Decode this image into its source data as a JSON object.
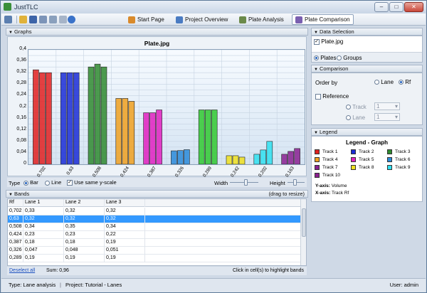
{
  "window": {
    "title": "JustTLC"
  },
  "toolbar": {
    "nav": [
      {
        "label": "Start Page",
        "color": "#d98a2b"
      },
      {
        "label": "Project Overview",
        "color": "#4a7bc2"
      },
      {
        "label": "Plate Analysis",
        "color": "#6b8a4a"
      },
      {
        "label": "Plate Comparison",
        "color": "#7a5fb0"
      }
    ]
  },
  "graphs_panel": {
    "header": "Graphs"
  },
  "chart_data": {
    "type": "bar",
    "title": "Plate.jpg",
    "categories": [
      "0,702",
      "0,63",
      "0,508",
      "0,424",
      "0,387",
      "0,326",
      "0,289",
      "0,242",
      "0,202",
      "0,163"
    ],
    "series": [
      {
        "name": "Track 1",
        "values": [
          0.33,
          0.32,
          0.34,
          0.23,
          0.18,
          0.047,
          0.19,
          0.03,
          0.035,
          0.035
        ],
        "color": "#e02020"
      },
      {
        "name": "Track 2",
        "values": [
          0.32,
          0.32,
          0.35,
          0.23,
          0.18,
          0.048,
          0.19,
          0.03,
          0.05,
          0.045
        ],
        "color": "#1a2bd6"
      },
      {
        "name": "Track 3",
        "values": [
          0.32,
          0.32,
          0.34,
          0.22,
          0.19,
          0.051,
          0.19,
          0.025,
          0.08,
          0.055
        ],
        "color": "#2f8a2f"
      }
    ],
    "bar_colors": [
      "#e02020",
      "#1a2bd6",
      "#2f8a2f",
      "#f0a020",
      "#e020c0",
      "#2a8ad8",
      "#30c830",
      "#f0e020",
      "#30e0f0",
      "#8a2090"
    ],
    "ylim": [
      0,
      0.4
    ],
    "yticks": [
      "0",
      "0,02",
      "0,04",
      "0,06",
      "0,08",
      "0,1",
      "0,12",
      "0,14",
      "0,16",
      "0,18",
      "0,2",
      "0,22",
      "0,24",
      "0,26",
      "0,28",
      "0,3",
      "0,32",
      "0,34",
      "0,36",
      "0,38",
      "0,4"
    ],
    "grid": true
  },
  "graph_controls": {
    "type_label": "Type",
    "bar_label": "Bar",
    "line_label": "Line",
    "same_scale_label": "Use same y-scale",
    "width_label": "Width",
    "height_label": "Height"
  },
  "bands_panel": {
    "header": "Bands",
    "hint": "(drag to resize)"
  },
  "bands_table": {
    "columns": [
      "Rf",
      "Lane 1",
      "Lane 2",
      "Lane 3"
    ],
    "rows": [
      [
        "0,702",
        "0,33",
        "0,32",
        "0,32"
      ],
      [
        "0,63",
        "0,32",
        "0,32",
        "0,32"
      ],
      [
        "0,508",
        "0,34",
        "0,35",
        "0,34"
      ],
      [
        "0,424",
        "0,23",
        "0,23",
        "0,22"
      ],
      [
        "0,387",
        "0,18",
        "0,18",
        "0,19"
      ],
      [
        "0,326",
        "0,047",
        "0,048",
        "0,051"
      ],
      [
        "0,289",
        "0,19",
        "0,19",
        "0,19"
      ]
    ]
  },
  "table_footer": {
    "deselect": "Deselect all",
    "sum": "Sum: 0,96",
    "hint": "Click in cell(s) to highlight bands"
  },
  "data_selection": {
    "header": "Data Selection",
    "item": "Plate.jpg",
    "plates_label": "Plates",
    "groups_label": "Groups"
  },
  "comparison": {
    "header": "Comparison",
    "order_by": "Order by",
    "lane_label": "Lane",
    "rf_label": "Rf",
    "reference_label": "Reference",
    "track_label": "Track",
    "lane2_label": "Lane",
    "track_value": "1",
    "lane_value": "1"
  },
  "legend": {
    "header": "Legend",
    "title": "Legend - Graph",
    "items": [
      {
        "label": "Track 1",
        "color": "#e02020"
      },
      {
        "label": "Track 2",
        "color": "#1a2bd6"
      },
      {
        "label": "Track 3",
        "color": "#2f8a2f"
      },
      {
        "label": "Track 4",
        "color": "#f0a020"
      },
      {
        "label": "Track 5",
        "color": "#e020c0"
      },
      {
        "label": "Track 6",
        "color": "#2a8ad8"
      },
      {
        "label": "Track 7",
        "color": "#8a2090"
      },
      {
        "label": "Track 8",
        "color": "#f0e020"
      },
      {
        "label": "Track 9",
        "color": "#30e0f0"
      },
      {
        "label": "Track 10",
        "color": "#8a2090"
      }
    ],
    "y_axis_label": "Y-axis:",
    "y_axis_value": "Volume",
    "x_axis_label": "X-axis:",
    "x_axis_value": "Track Rf"
  },
  "statusbar": {
    "type": "Type:  Lane analysis",
    "project": "Project:  Tutorial - Lanes",
    "user": "User:  admin"
  }
}
